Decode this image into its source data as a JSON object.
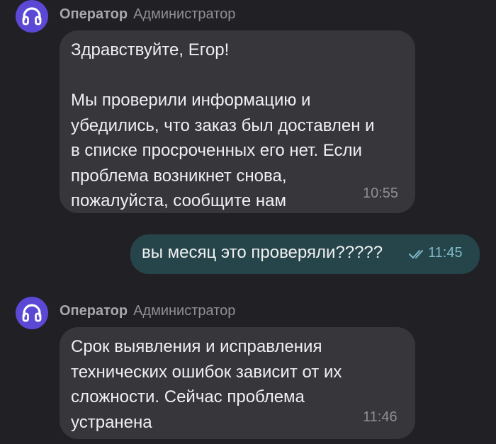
{
  "messages": [
    {
      "sender_name": "Оператор",
      "sender_role": "Администратор",
      "avatar_icon": "headphones-icon",
      "text": "Здравствуйте, Егор!\n\nМы проверили информацию и\nубедились, что заказ был доставлен и\nв списке просроченных его нет. Если\nпроблема возникнет снова,\nпожалуйста, сообщите нам",
      "time": "10:55"
    },
    {
      "text": "вы месяц это проверяли?????",
      "time": "11:45",
      "status_icon": "double-check-icon"
    },
    {
      "sender_name": "Оператор",
      "sender_role": "Администратор",
      "avatar_icon": "headphones-icon",
      "text": "Срок выявления и исправления\nтехнических ошибок зависит от их\nсложности. Сейчас проблема\nустранена",
      "time": "11:46"
    }
  ],
  "colors": {
    "background": "#202025",
    "incoming_bubble": "#36363b",
    "outgoing_bubble": "#25454a",
    "avatar": "#5b49d6",
    "outgoing_time": "#7fb9c6"
  }
}
